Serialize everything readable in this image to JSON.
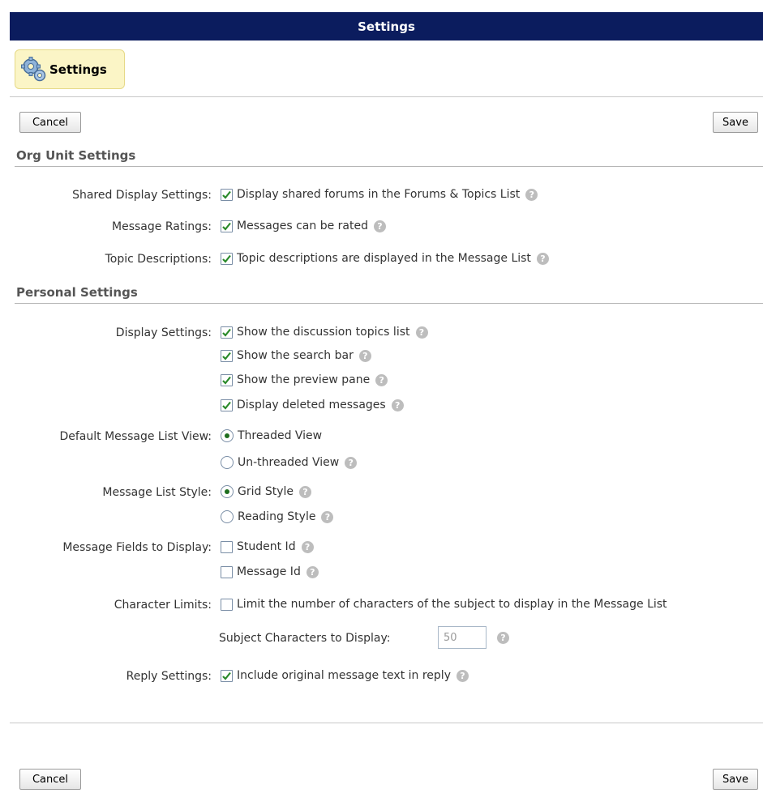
{
  "window": {
    "title": "Settings"
  },
  "header_pill": {
    "label": "Settings",
    "icon": "gears-icon"
  },
  "toolbar": {
    "cancel_label": "Cancel",
    "save_label": "Save"
  },
  "org_unit": {
    "heading": "Org Unit Settings",
    "shared_display": {
      "label": "Shared Display Settings:",
      "option": "Display shared forums in the Forums & Topics List",
      "checked": true
    },
    "message_ratings": {
      "label": "Message Ratings:",
      "option": "Messages can be rated",
      "checked": true
    },
    "topic_descriptions": {
      "label": "Topic Descriptions:",
      "option": "Topic descriptions are displayed in the Message List",
      "checked": true
    }
  },
  "personal": {
    "heading": "Personal Settings",
    "display_settings": {
      "label": "Display Settings:",
      "options": [
        {
          "text": "Show the discussion topics list",
          "checked": true
        },
        {
          "text": "Show the search bar",
          "checked": true
        },
        {
          "text": "Show the preview pane",
          "checked": true
        },
        {
          "text": "Display deleted messages",
          "checked": true
        }
      ]
    },
    "default_view": {
      "label": "Default Message List View:",
      "options": [
        {
          "text": "Threaded View",
          "selected": true
        },
        {
          "text": "Un-threaded View",
          "selected": false
        }
      ]
    },
    "list_style": {
      "label": "Message List Style:",
      "options": [
        {
          "text": "Grid Style",
          "selected": true
        },
        {
          "text": "Reading Style",
          "selected": false
        }
      ]
    },
    "fields": {
      "label": "Message Fields to Display:",
      "options": [
        {
          "text": "Student Id",
          "checked": false
        },
        {
          "text": "Message Id",
          "checked": false
        }
      ]
    },
    "char_limits": {
      "label": "Character Limits:",
      "option": "Limit the number of characters of the subject to display in the Message List",
      "checked": false,
      "subject_label": "Subject Characters to Display:",
      "subject_value": "50"
    },
    "reply": {
      "label": "Reply Settings:",
      "option": "Include original message text in reply",
      "checked": true
    }
  },
  "help_glyph": "?",
  "colors": {
    "title_bar": "#0b1c5e",
    "check": "#2a8a2a",
    "pill_bg": "#fbf5c6"
  }
}
